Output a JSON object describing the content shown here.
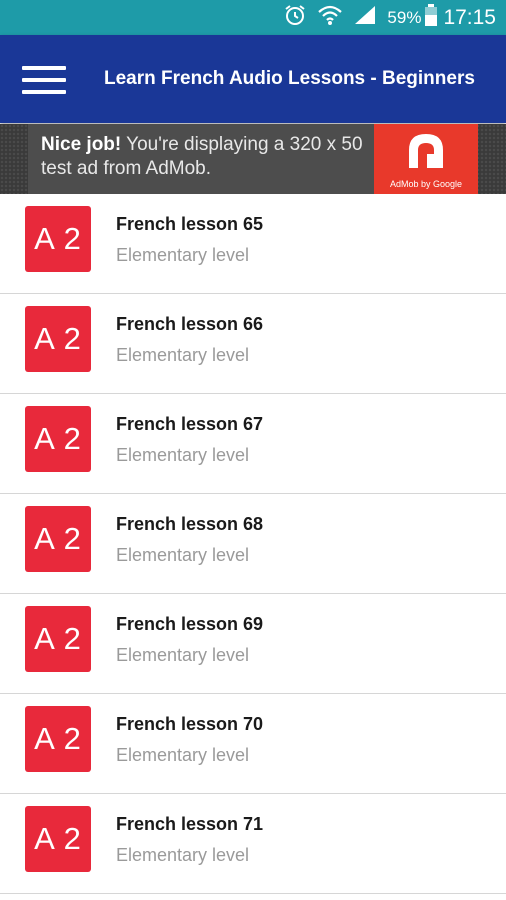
{
  "status_bar": {
    "icons": [
      "alarm-icon",
      "wifi-icon",
      "signal-icon",
      "battery-icon"
    ],
    "battery": "59%",
    "time": "17:15",
    "color": "#1e9ba8"
  },
  "app_bar": {
    "title": "Learn French Audio Lessons - Beginners",
    "menu_icon": "hamburger-menu-icon",
    "color": "#1a3797"
  },
  "ad": {
    "headline": "Nice job!",
    "body": "You're displaying a 320 x 50 test ad from AdMob.",
    "brand": "AdMob by Google",
    "brand_color": "#e8392b"
  },
  "lessons": [
    {
      "badge": "A 2",
      "title": "French lesson 65",
      "level": "Elementary level"
    },
    {
      "badge": "A 2",
      "title": "French lesson 66",
      "level": "Elementary level"
    },
    {
      "badge": "A 2",
      "title": "French lesson 67",
      "level": "Elementary level"
    },
    {
      "badge": "A 2",
      "title": "French lesson 68",
      "level": "Elementary level"
    },
    {
      "badge": "A 2",
      "title": "French lesson 69",
      "level": "Elementary level"
    },
    {
      "badge": "A 2",
      "title": "French lesson 70",
      "level": "Elementary level"
    },
    {
      "badge": "A 2",
      "title": "French lesson 71",
      "level": "Elementary level"
    }
  ],
  "badge_color": "#e8293b"
}
